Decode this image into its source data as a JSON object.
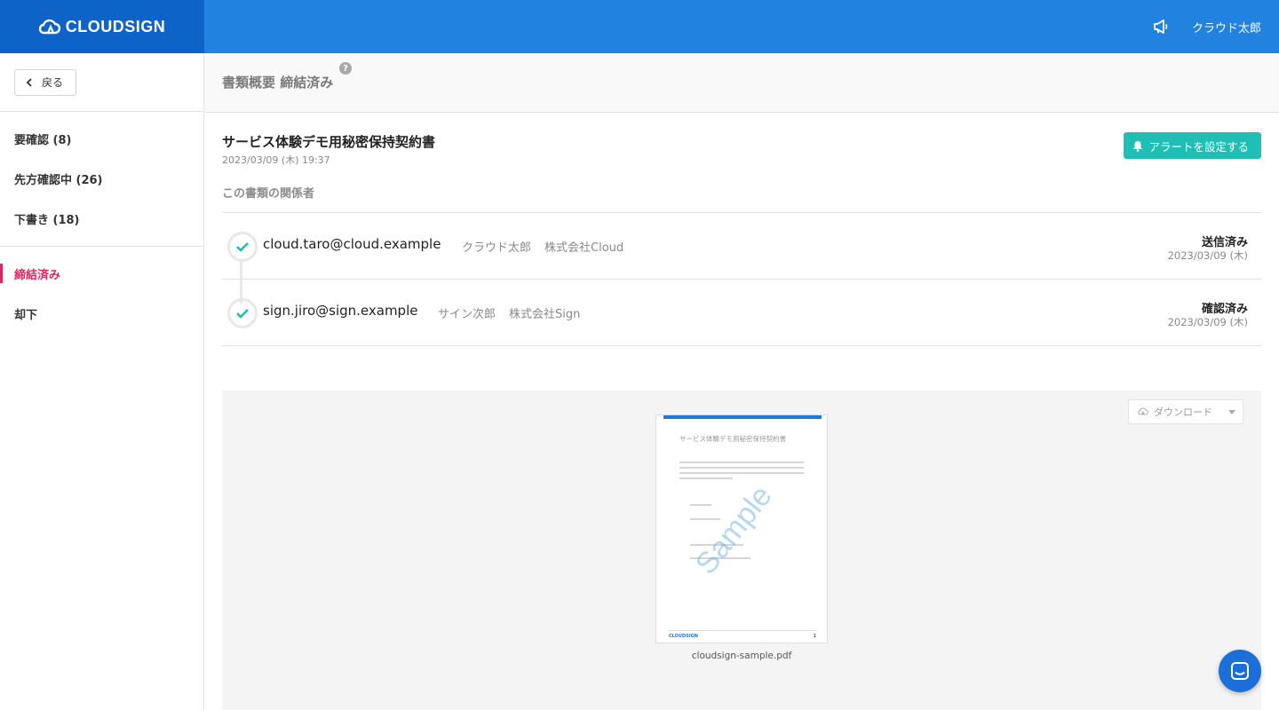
{
  "header": {
    "logo_text": "CLOUDSIGN",
    "user_name": "クラウド太郎",
    "icons": {
      "logo": "cloud-logo-icon",
      "announce": "megaphone-icon"
    }
  },
  "sidebar": {
    "back_label": "戻る",
    "items": [
      {
        "label": "要確認 (8)"
      },
      {
        "label": "先方確認中 (26)"
      },
      {
        "label": "下書き (18)"
      },
      {
        "label": "締結済み",
        "active": true
      },
      {
        "label": "却下"
      }
    ]
  },
  "page": {
    "title": "書類概要 締結済み",
    "help": "?"
  },
  "document": {
    "title": "サービス体験デモ用秘密保持契約書",
    "date": "2023/03/09 (木) 19:37",
    "alert_button": "アラートを設定する",
    "parties_label": "この書類の関係者",
    "parties": [
      {
        "email": "cloud.taro@cloud.example",
        "name": "クラウド太郎",
        "company": "株式会社Cloud",
        "status": "送信済み",
        "status_date": "2023/03/09 (木)"
      },
      {
        "email": "sign.jiro@sign.example",
        "name": "サイン次郎",
        "company": "株式会社Sign",
        "status": "確認済み",
        "status_date": "2023/03/09 (木)"
      }
    ]
  },
  "preview": {
    "download_label": "ダウンロード",
    "thumb_title": "サービス体験デモ用秘密保持契約書",
    "thumb_watermark": "Sample",
    "thumb_footer_logo": "CLOUDSIGN",
    "thumb_footer_page": "1",
    "filename": "cloudsign-sample.pdf"
  },
  "colors": {
    "header_blue": "#2282e0",
    "logo_blue": "#0e63c8",
    "active_pink": "#e0245e",
    "teal": "#1fbfb5",
    "chat_blue": "#1c6fd8"
  }
}
